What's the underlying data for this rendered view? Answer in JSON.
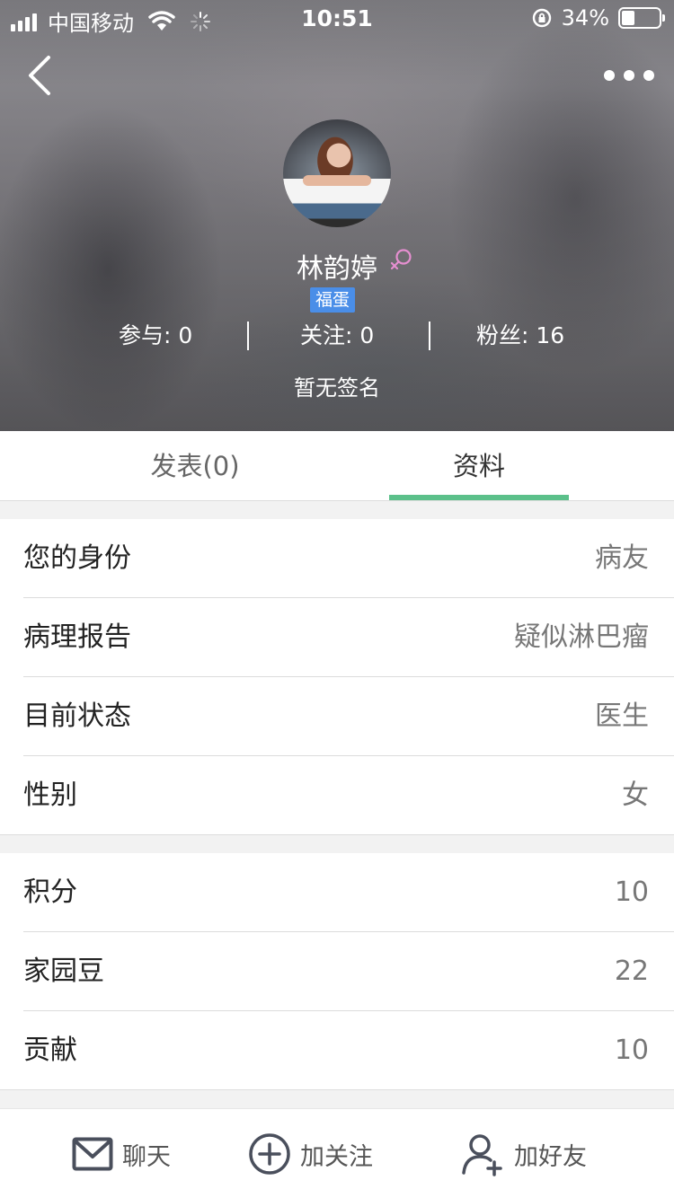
{
  "status_bar": {
    "carrier": "中国移动",
    "time": "10:51",
    "battery": "34%",
    "battery_level": 0.34
  },
  "profile": {
    "name": "林韵婷",
    "gender": "female",
    "badge": "福蛋",
    "signature": "暂无签名",
    "stats": [
      {
        "label": "参与: 0"
      },
      {
        "label": "关注: 0"
      },
      {
        "label": "粉丝: 16"
      }
    ]
  },
  "tabs": [
    {
      "label": "发表(0)",
      "active": false
    },
    {
      "label": "资料",
      "active": true
    }
  ],
  "info_group_1": [
    {
      "label": "您的身份",
      "value": "病友"
    },
    {
      "label": "病理报告",
      "value": "疑似淋巴瘤"
    },
    {
      "label": "目前状态",
      "value": "医生"
    },
    {
      "label": "性别",
      "value": "女"
    }
  ],
  "info_group_2": [
    {
      "label": "积分",
      "value": "10"
    },
    {
      "label": "家园豆",
      "value": "22"
    },
    {
      "label": "贡献",
      "value": "10"
    }
  ],
  "actions": {
    "chat": "聊天",
    "follow": "加关注",
    "add_friend": "加好友"
  },
  "colors": {
    "accent": "#5bc08a",
    "badge": "#4a8ee8",
    "gender_female": "#e58fd0",
    "icon": "#4a4f5c"
  }
}
